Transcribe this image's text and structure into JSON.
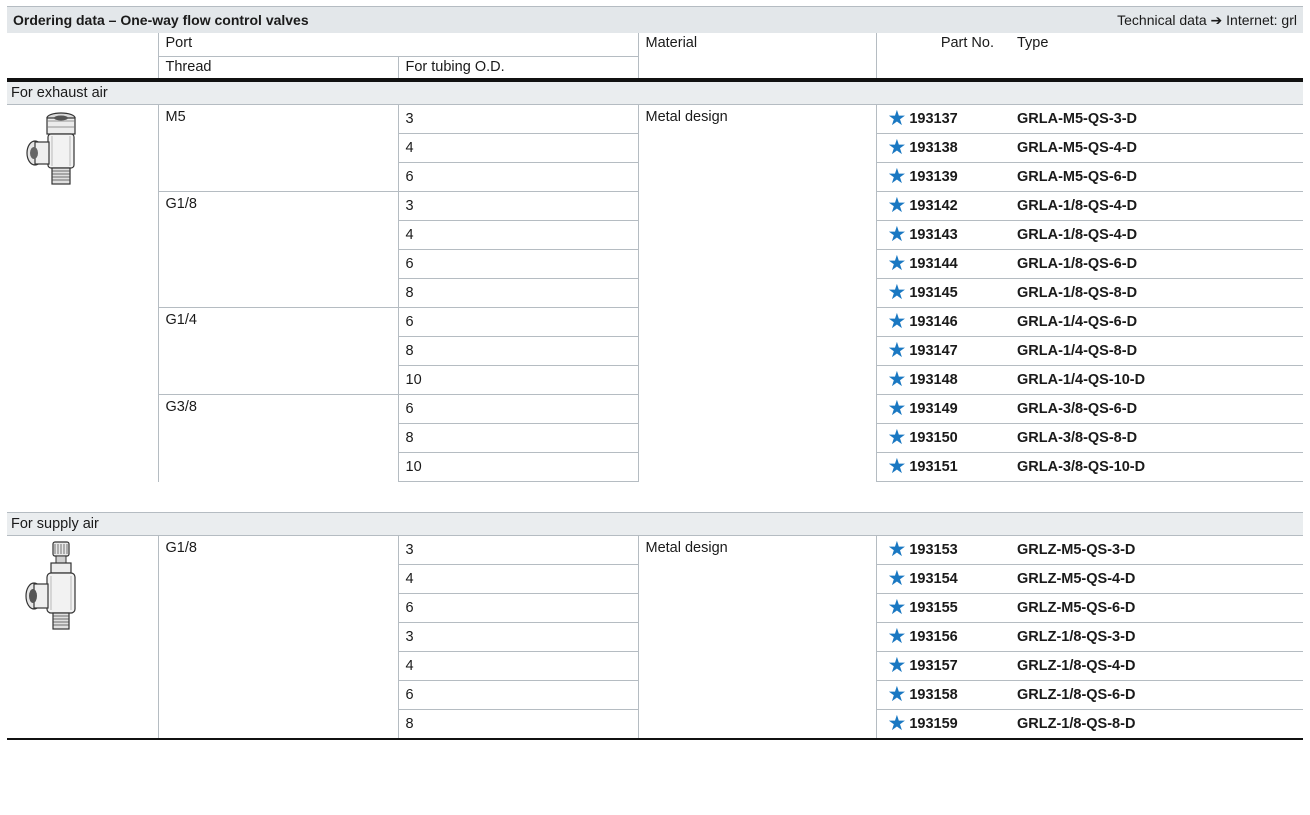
{
  "title": "Ordering data – One-way flow control valves",
  "tech_label": "Technical data",
  "tech_arrow": "➔",
  "tech_link": "Internet: grl",
  "headers": {
    "port": "Port",
    "thread": "Thread",
    "tubing": "For tubing O.D.",
    "material": "Material",
    "partno": "Part No.",
    "type": "Type"
  },
  "sections": [
    {
      "label": "For exhaust air",
      "material": "Metal design",
      "image_icon": "one-way-flow-control-valve-exhaust-icon",
      "groups": [
        {
          "thread": "M5",
          "rows": [
            {
              "od": "3",
              "part": "193137",
              "type": "GRLA-M5-QS-3-D"
            },
            {
              "od": "4",
              "part": "193138",
              "type": "GRLA-M5-QS-4-D"
            },
            {
              "od": "6",
              "part": "193139",
              "type": "GRLA-M5-QS-6-D"
            }
          ]
        },
        {
          "thread": "G1/8",
          "rows": [
            {
              "od": "3",
              "part": "193142",
              "type": "GRLA-1/8-QS-4-D"
            },
            {
              "od": "4",
              "part": "193143",
              "type": "GRLA-1/8-QS-4-D"
            },
            {
              "od": "6",
              "part": "193144",
              "type": "GRLA-1/8-QS-6-D"
            },
            {
              "od": "8",
              "part": "193145",
              "type": "GRLA-1/8-QS-8-D"
            }
          ]
        },
        {
          "thread": "G1/4",
          "rows": [
            {
              "od": "6",
              "part": "193146",
              "type": "GRLA-1/4-QS-6-D"
            },
            {
              "od": "8",
              "part": "193147",
              "type": "GRLA-1/4-QS-8-D"
            },
            {
              "od": "10",
              "part": "193148",
              "type": "GRLA-1/4-QS-10-D"
            }
          ]
        },
        {
          "thread": "G3/8",
          "rows": [
            {
              "od": "6",
              "part": "193149",
              "type": "GRLA-3/8-QS-6-D"
            },
            {
              "od": "8",
              "part": "193150",
              "type": "GRLA-3/8-QS-8-D"
            },
            {
              "od": "10",
              "part": "193151",
              "type": "GRLA-3/8-QS-10-D"
            }
          ]
        }
      ]
    },
    {
      "label": "For supply air",
      "material": "Metal design",
      "image_icon": "one-way-flow-control-valve-supply-icon",
      "groups": [
        {
          "thread": "G1/8",
          "rows": [
            {
              "od": "3",
              "part": "193153",
              "type": "GRLZ-M5-QS-3-D"
            },
            {
              "od": "4",
              "part": "193154",
              "type": "GRLZ-M5-QS-4-D"
            },
            {
              "od": "6",
              "part": "193155",
              "type": "GRLZ-M5-QS-6-D"
            },
            {
              "od": "3",
              "part": "193156",
              "type": "GRLZ-1/8-QS-3-D"
            },
            {
              "od": "4",
              "part": "193157",
              "type": "GRLZ-1/8-QS-4-D"
            },
            {
              "od": "6",
              "part": "193158",
              "type": "GRLZ-1/8-QS-6-D"
            },
            {
              "od": "8",
              "part": "193159",
              "type": "GRLZ-1/8-QS-8-D"
            }
          ]
        }
      ]
    }
  ],
  "icons": {
    "core_range": "star-icon",
    "core_range_color": "#1a78c2"
  }
}
